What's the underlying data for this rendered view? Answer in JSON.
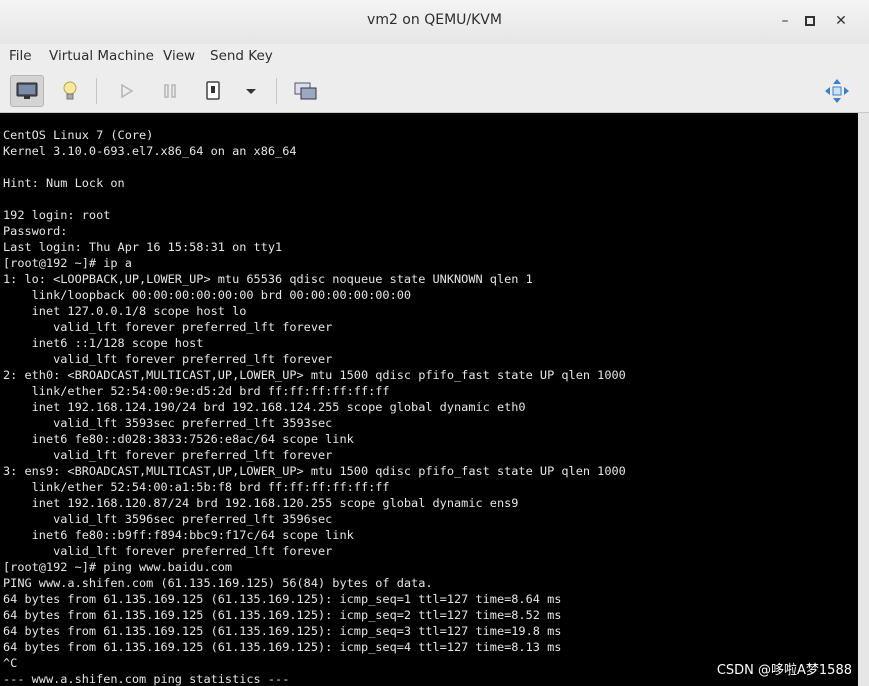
{
  "window": {
    "title": "vm2 on QEMU/KVM",
    "controls": {
      "minimize": "–",
      "maximize": "▫",
      "close": "✕"
    }
  },
  "menubar": {
    "items": [
      "File",
      "Virtual Machine",
      "View",
      "Send Key"
    ]
  },
  "toolbar": {
    "buttons": [
      {
        "name": "console-view-button",
        "icon": "monitor-icon",
        "active": true
      },
      {
        "name": "details-view-button",
        "icon": "lightbulb-icon",
        "active": false
      },
      {
        "name": "run-button",
        "icon": "play-icon",
        "active": false
      },
      {
        "name": "pause-button",
        "icon": "pause-icon",
        "active": false
      },
      {
        "name": "shutdown-button",
        "icon": "power-icon",
        "active": false
      },
      {
        "name": "shutdown-menu-button",
        "icon": "chevron-down-icon",
        "active": false
      },
      {
        "name": "snapshots-button",
        "icon": "snapshot-icon",
        "active": false
      },
      {
        "name": "fullscreen-button",
        "icon": "fullscreen-icon",
        "active": false
      }
    ]
  },
  "console": {
    "lines": [
      "CentOS Linux 7 (Core)",
      "Kernel 3.10.0-693.el7.x86_64 on an x86_64",
      "",
      "Hint: Num Lock on",
      "",
      "192 login: root",
      "Password:",
      "Last login: Thu Apr 16 15:58:31 on tty1",
      "[root@192 ~]# ip a",
      "1: lo: <LOOPBACK,UP,LOWER_UP> mtu 65536 qdisc noqueue state UNKNOWN qlen 1",
      "    link/loopback 00:00:00:00:00:00 brd 00:00:00:00:00:00",
      "    inet 127.0.0.1/8 scope host lo",
      "       valid_lft forever preferred_lft forever",
      "    inet6 ::1/128 scope host",
      "       valid_lft forever preferred_lft forever",
      "2: eth0: <BROADCAST,MULTICAST,UP,LOWER_UP> mtu 1500 qdisc pfifo_fast state UP qlen 1000",
      "    link/ether 52:54:00:9e:d5:2d brd ff:ff:ff:ff:ff:ff",
      "    inet 192.168.124.190/24 brd 192.168.124.255 scope global dynamic eth0",
      "       valid_lft 3593sec preferred_lft 3593sec",
      "    inet6 fe80::d028:3833:7526:e8ac/64 scope link",
      "       valid_lft forever preferred_lft forever",
      "3: ens9: <BROADCAST,MULTICAST,UP,LOWER_UP> mtu 1500 qdisc pfifo_fast state UP qlen 1000",
      "    link/ether 52:54:00:a1:5b:f8 brd ff:ff:ff:ff:ff:ff",
      "    inet 192.168.120.87/24 brd 192.168.120.255 scope global dynamic ens9",
      "       valid_lft 3596sec preferred_lft 3596sec",
      "    inet6 fe80::b9ff:f894:bbc9:f17c/64 scope link",
      "       valid_lft forever preferred_lft forever",
      "[root@192 ~]# ping www.baidu.com",
      "PING www.a.shifen.com (61.135.169.125) 56(84) bytes of data.",
      "64 bytes from 61.135.169.125 (61.135.169.125): icmp_seq=1 ttl=127 time=8.64 ms",
      "64 bytes from 61.135.169.125 (61.135.169.125): icmp_seq=2 ttl=127 time=8.52 ms",
      "64 bytes from 61.135.169.125 (61.135.169.125): icmp_seq=3 ttl=127 time=19.8 ms",
      "64 bytes from 61.135.169.125 (61.135.169.125): icmp_seq=4 ttl=127 time=8.13 ms",
      "^C",
      "--- www.a.shifen.com ping statistics ---"
    ]
  },
  "watermark": "CSDN @哆啦A梦1588",
  "colors": {
    "console_bg": "#000000",
    "console_fg": "#e6e6e6",
    "chrome_bg": "#ededed"
  }
}
